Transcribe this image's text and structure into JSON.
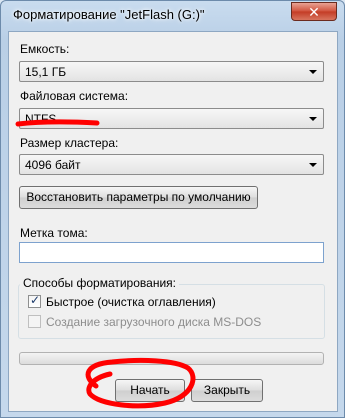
{
  "window": {
    "title": "Форматирование \"JetFlash (G:)\"",
    "close_glyph": "✕"
  },
  "capacity": {
    "label": "Емкость:",
    "value": "15,1 ГБ"
  },
  "filesystem": {
    "label": "Файловая система:",
    "value": "NTFS"
  },
  "cluster": {
    "label": "Размер кластера:",
    "value": "4096 байт"
  },
  "restore_button": "Восстановить параметры по умолчанию",
  "volume_label": {
    "label": "Метка тома:",
    "value": ""
  },
  "format_options": {
    "title": "Способы форматирования:",
    "quick": {
      "label": "Быстрое (очистка оглавления)",
      "checked": true
    },
    "msdos": {
      "label": "Создание загрузочного диска MS-DOS",
      "checked": false,
      "enabled": false
    }
  },
  "progress": {
    "fraction": 0
  },
  "buttons": {
    "start": "Начать",
    "close": "Закрыть"
  },
  "colors": {
    "annotation_red": "#ff0000",
    "client_bg": "#f0f0f0",
    "titlebar": "#c9dcef"
  }
}
